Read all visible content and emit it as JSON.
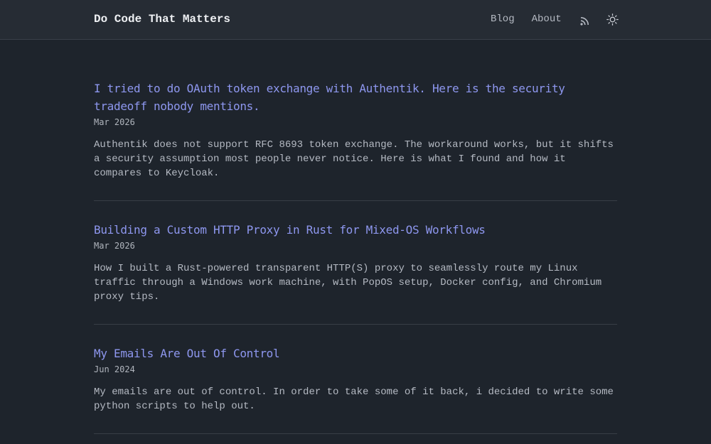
{
  "header": {
    "site_title": "Do Code That Matters",
    "nav": {
      "blog": "Blog",
      "about": "About"
    },
    "icons": [
      "rss-icon",
      "sun-icon"
    ]
  },
  "posts": [
    {
      "title": "I tried to do OAuth token exchange with Authentik. Here is the security tradeoff nobody mentions.",
      "date": "Mar 2026",
      "summary": "Authentik does not support RFC 8693 token exchange. The workaround works, but it shifts a security assumption most people never notice. Here is what I found and how it compares to Keycloak."
    },
    {
      "title": "Building a Custom HTTP Proxy in Rust for Mixed-OS Workflows",
      "date": "Mar 2026",
      "summary": "How I built a Rust-powered transparent HTTP(S) proxy to seamlessly route my Linux traffic through a Windows work machine, with PopOS setup, Docker config, and Chromium proxy tips."
    },
    {
      "title": "My Emails Are Out Of Control",
      "date": "Jun 2024",
      "summary": "My emails are out of control. In order to take some of it back, i decided to write some python scripts to help out."
    }
  ],
  "colors": {
    "background": "#1e242c",
    "header_background": "#262c34",
    "link": "#8e97ef",
    "text": "#b5bac3",
    "title": "#eef0f3"
  }
}
